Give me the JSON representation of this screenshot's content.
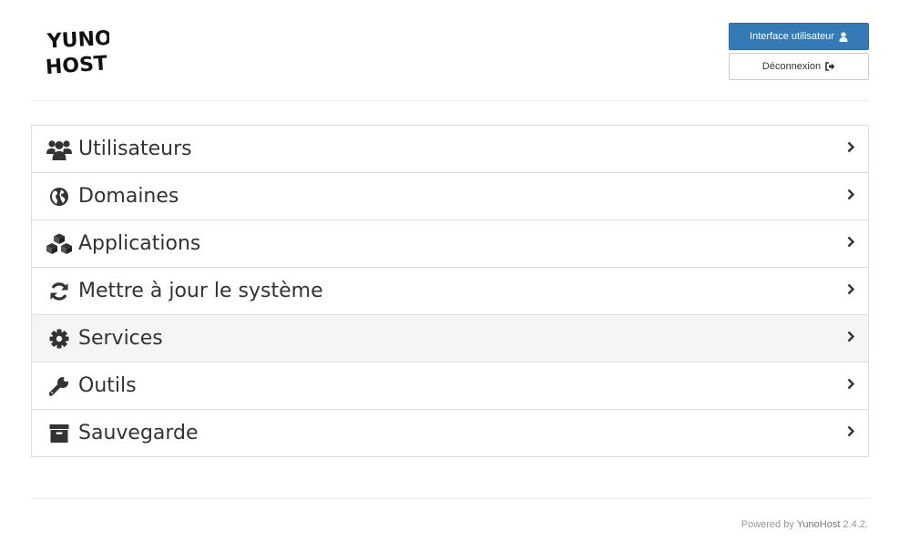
{
  "logo": {
    "line1": "YUNO",
    "line2": "HOST"
  },
  "header": {
    "user_interface_label": "Interface utilisateur",
    "logout_label": "Déconnexion"
  },
  "menu": {
    "items": [
      {
        "label": "Utilisateurs",
        "icon": "users-icon"
      },
      {
        "label": "Domaines",
        "icon": "globe-icon"
      },
      {
        "label": "Applications",
        "icon": "cubes-icon"
      },
      {
        "label": "Mettre à jour le système",
        "icon": "refresh-icon"
      },
      {
        "label": "Services",
        "icon": "gear-icon",
        "active": true
      },
      {
        "label": "Outils",
        "icon": "wrench-icon"
      },
      {
        "label": "Sauvegarde",
        "icon": "archive-icon"
      }
    ]
  },
  "footer": {
    "prefix": "Powered by",
    "brand": "YunoHost",
    "version": "2.4.2."
  },
  "colors": {
    "primary": "#337ab7",
    "active_row": "#f5f5f5",
    "text": "#333333"
  }
}
